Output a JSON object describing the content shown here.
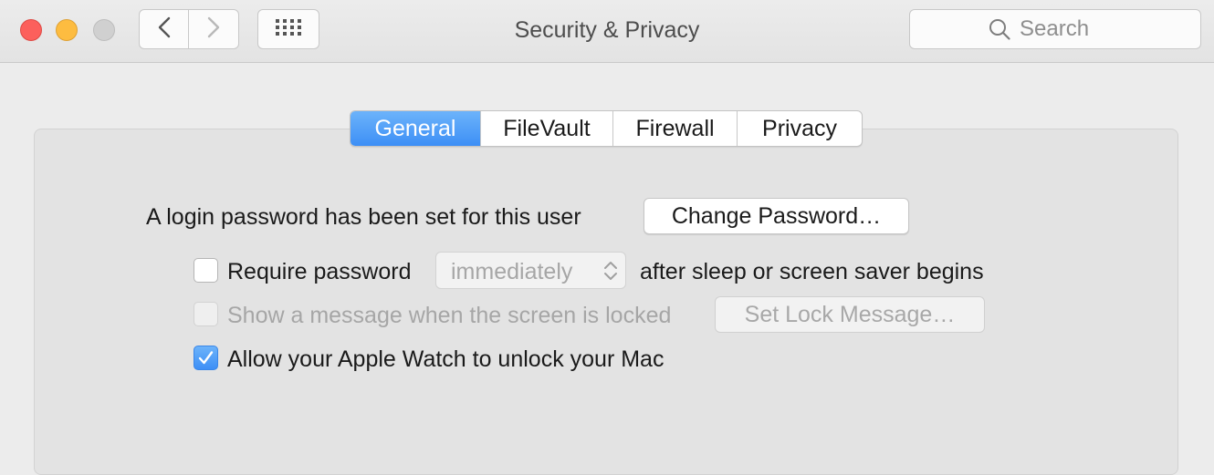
{
  "window": {
    "title": "Security & Privacy",
    "traffic_colors": {
      "close": "#fc605c",
      "minimize": "#fdbc40",
      "zoom": "#d0d0d0"
    }
  },
  "toolbar": {
    "back_icon": "chevron-left-icon",
    "forward_icon": "chevron-right-icon",
    "grid_icon": "grid-icon",
    "search": {
      "placeholder": "Search",
      "value": "",
      "icon": "search-icon"
    }
  },
  "tabs": [
    {
      "label": "General",
      "selected": true
    },
    {
      "label": "FileVault",
      "selected": false
    },
    {
      "label": "Firewall",
      "selected": false
    },
    {
      "label": "Privacy",
      "selected": false
    }
  ],
  "general": {
    "login_password_text": "A login password has been set for this user",
    "change_password_button": "Change Password…",
    "require_password": {
      "label": "Require password",
      "checked": false,
      "delay_value": "immediately",
      "suffix": "after sleep or screen saver begins"
    },
    "show_message": {
      "label": "Show a message when the screen is locked",
      "checked": false,
      "enabled": false,
      "button": "Set Lock Message…"
    },
    "apple_watch": {
      "label": "Allow your Apple Watch to unlock your Mac",
      "checked": true
    }
  },
  "colors": {
    "accent": "#3d8ff6",
    "disabled_text": "#a6a6a6"
  }
}
